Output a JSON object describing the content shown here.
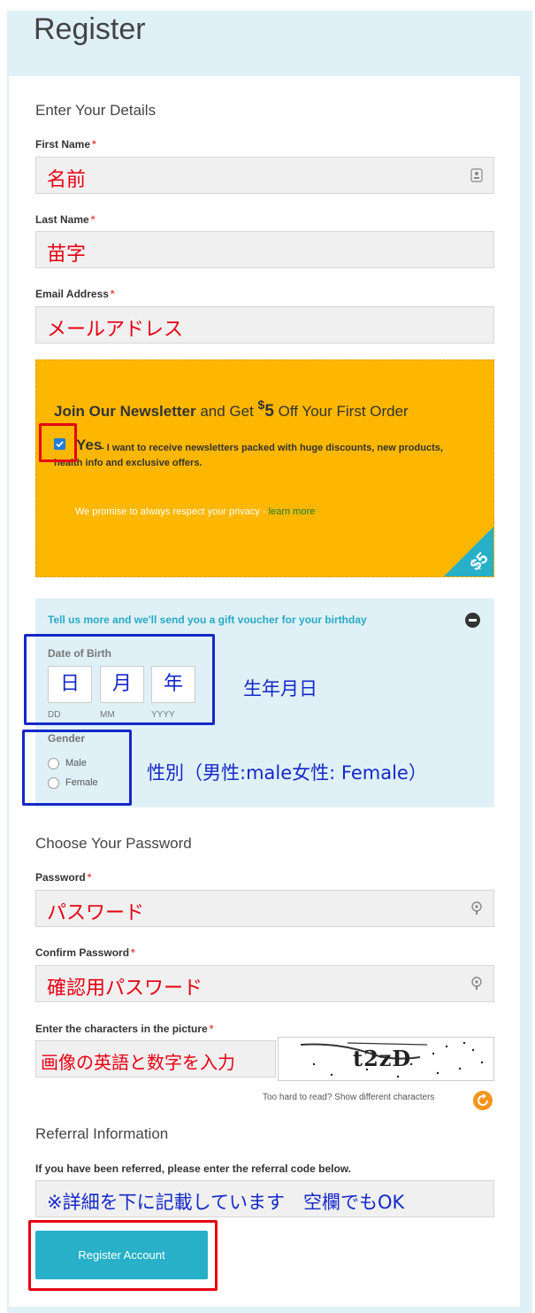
{
  "page": {
    "title": "Register"
  },
  "details": {
    "heading": "Enter Your Details",
    "first_name_label": "First Name",
    "first_name_value": "名前",
    "last_name_label": "Last Name",
    "last_name_value": "苗字",
    "email_label": "Email Address",
    "email_value": "メールアドレス",
    "required_mark": "*"
  },
  "newsletter": {
    "heading_bold": "Join Our Newsletter",
    "heading_mid": " and Get ",
    "heading_dollar": "$",
    "heading_five": "5",
    "heading_end": " Off Your First Order",
    "checked": true,
    "yes_label": "Yes",
    "desc_line1": "- I want to receive newsletters packed with huge discounts, new products,",
    "desc_line2": "health info and exclusive offers.",
    "privacy_text": "We promise to always respect your privacy - ",
    "learn_more": "learn more",
    "corner_text": "$5",
    "colors": {
      "background": "#fdb700",
      "corner": "#27b0c8"
    }
  },
  "birthday": {
    "heading": "Tell us more and we'll send you a gift voucher for your birthday",
    "dob_label": "Date of Birth",
    "day_value": "日",
    "month_value": "月",
    "year_value": "年",
    "day_hint": "DD",
    "month_hint": "MM",
    "year_hint": "YYYY",
    "dob_annotation": "生年月日",
    "gender_label": "Gender",
    "gender_options": [
      "Male",
      "Female"
    ],
    "gender_annotation": "性別（男性:male女性: Female）"
  },
  "password": {
    "heading": "Choose Your Password",
    "password_label": "Password",
    "password_value": "パスワード",
    "confirm_label": "Confirm Password",
    "confirm_value": "確認用パスワード"
  },
  "captcha": {
    "label": "Enter the characters in the picture",
    "input_value": "画像の英語と数字を入力",
    "image_text": "t2zD",
    "refresh_text": "Too hard to read? Show different characters"
  },
  "referral": {
    "heading": "Referral Information",
    "description": "If you have been referred, please enter the referral code below.",
    "value": "※詳細を下に記載しています　空欄でもOK"
  },
  "submit": {
    "label": "Register Account"
  },
  "colors": {
    "annotation_red": "#e60012",
    "annotation_blue": "#1428c8",
    "accent": "#27b0c8"
  }
}
